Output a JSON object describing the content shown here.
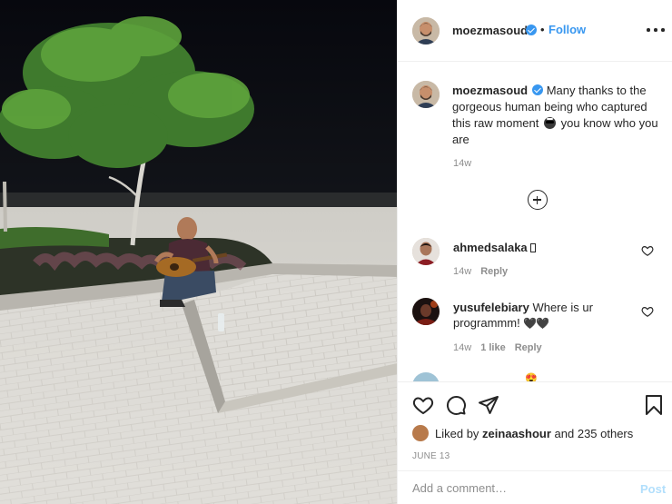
{
  "post": {
    "author": "moezmasoud",
    "verified": true,
    "follow_sep": "•",
    "follow_label": "Follow",
    "more_icon": "more-options-icon"
  },
  "caption": {
    "username": "moezmasoud",
    "text_before_emoji": "Many thanks to the gorgeous human being who captured this raw moment",
    "emoji": "sunglasses-emoji",
    "text_after_emoji": "you know who you are",
    "time": "14w"
  },
  "comments": [
    {
      "username": "ahmedsalaka",
      "text": "",
      "time": "14w",
      "reply_label": "Reply"
    },
    {
      "username": "yusufelebiary",
      "text": "Where is ur programmm!",
      "emoji_text": "🖤🖤",
      "time": "14w",
      "likes_label": "1 like",
      "reply_label": "Reply"
    }
  ],
  "partial_comment_emoji": "😍",
  "likes": {
    "prefix": "Liked by",
    "user": "zeinaashour",
    "suffix": "and 235 others"
  },
  "date": "JUNE 13",
  "add_comment": {
    "placeholder": "Add a comment…",
    "post_label": "Post"
  },
  "colors": {
    "link_blue": "#3897f0",
    "post_disabled": "#b2dffc",
    "muted": "#8e8e8e"
  }
}
